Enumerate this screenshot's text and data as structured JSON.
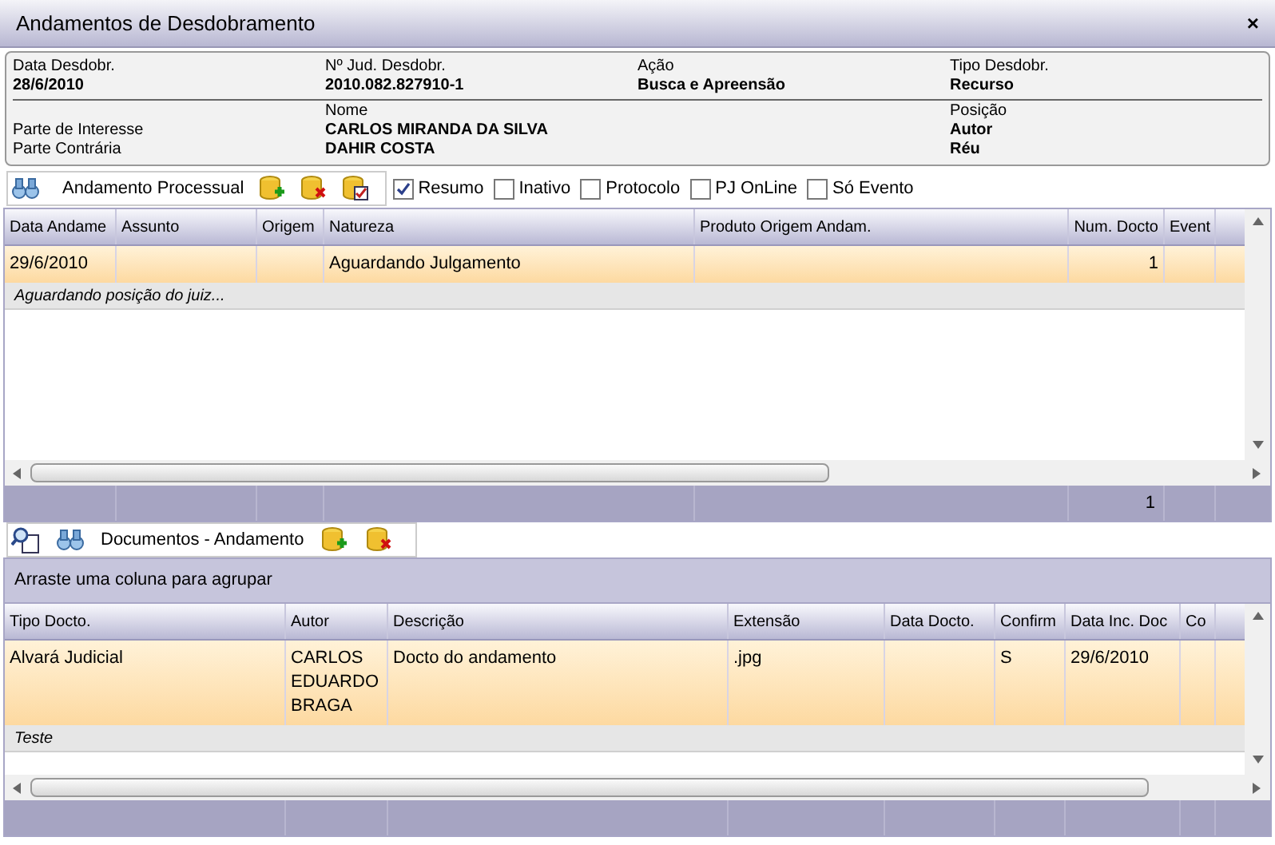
{
  "window": {
    "title": "Andamentos de Desdobramento",
    "close": "×"
  },
  "header": {
    "top": [
      {
        "label": "Data Desdobr.",
        "value": "28/6/2010"
      },
      {
        "label": "Nº Jud. Desdobr.",
        "value": "2010.082.827910-1"
      },
      {
        "label": "Ação",
        "value": "Busca e Apreensão"
      },
      {
        "label": "Tipo Desdobr.",
        "value": "Recurso"
      }
    ],
    "name_label": "Nome",
    "position_label": "Posição",
    "parties": [
      {
        "role": "Parte de Interesse",
        "name": "CARLOS MIRANDA DA SILVA",
        "position": "Autor"
      },
      {
        "role": "Parte Contrária",
        "name": "DAHIR COSTA",
        "position": "Réu"
      }
    ]
  },
  "toolbar1": {
    "title": "Andamento Processual",
    "filters": [
      {
        "label": "Resumo",
        "checked": true
      },
      {
        "label": "Inativo",
        "checked": false
      },
      {
        "label": "Protocolo",
        "checked": false
      },
      {
        "label": "PJ OnLine",
        "checked": false
      },
      {
        "label": "Só Evento",
        "checked": false
      }
    ]
  },
  "grid1": {
    "columns": [
      "Data Andame",
      "Assunto",
      "Origem",
      "Natureza",
      "Produto Origem Andam.",
      "Num. Docto",
      "Event"
    ],
    "rows": [
      {
        "cells": [
          "29/6/2010",
          "",
          "",
          "Aguardando Julgamento",
          "",
          "1",
          ""
        ],
        "note": "Aguardando posição do juiz...",
        "selected": true
      }
    ],
    "footer_count": "1"
  },
  "toolbar2": {
    "title": "Documentos - Andamento"
  },
  "grid2": {
    "group_hint": "Arraste uma coluna para agrupar",
    "columns": [
      "Tipo Docto.",
      "Autor",
      "Descrição",
      "Extensão",
      "Data Docto.",
      "Confirm",
      "Data Inc. Doc",
      "Co"
    ],
    "rows": [
      {
        "cells": [
          "Alvará Judicial",
          "CARLOS EDUARDO BRAGA",
          "Docto do andamento",
          ".jpg",
          "",
          "S",
          "29/6/2010",
          ""
        ],
        "note": "Teste",
        "selected": true
      }
    ]
  }
}
